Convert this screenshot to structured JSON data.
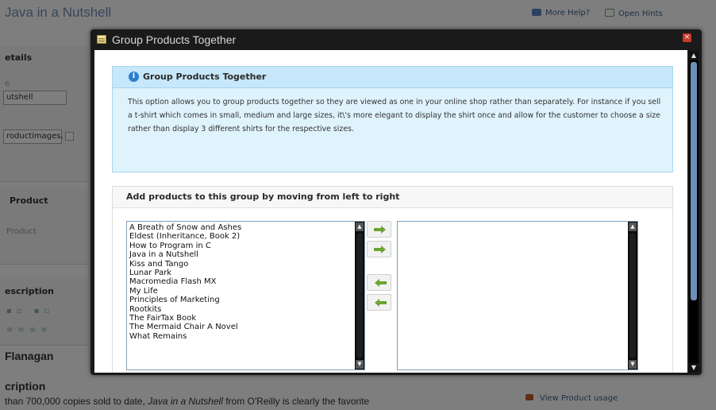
{
  "background": {
    "title": "Java in a Nutshell",
    "more_help": "More Help?",
    "open_hints": "Open Hints",
    "details_heading": "etails",
    "field_label_e": "e",
    "field_value_name": "utshell",
    "field_value_images": "roductimages,",
    "product_heading": "Product",
    "product_sub": "Product",
    "description_heading": "escription",
    "author": "Flanagan",
    "desc_heading2": "cription",
    "desc_text_prefix": "than 700,000 copies sold to date, ",
    "desc_text_italic": "Java in a Nutshell",
    "desc_text_suffix": " from O'Reilly is clearly the favorite",
    "view_usage": "View Product usage"
  },
  "dialog": {
    "title": "Group Products Together",
    "close_glyph": "×",
    "info": {
      "title": "Group Products Together",
      "icon_glyph": "i",
      "text": "This option allows you to group products together so they are viewed as one in your online shop rather than separately. For instance if you sell a t-shirt which comes in small, medium and large sizes, it\\'s more elegant to display the shirt once and allow for the customer to choose a size rather than display 3 different shirts for the respective sizes."
    },
    "add_panel": {
      "title": "Add products to this group by moving from left to right",
      "available_products": [
        "A Breath of Snow and Ashes",
        "Eldest (Inheritance, Book 2)",
        "How to Program in C",
        "Java in a Nutshell",
        "Kiss and Tango",
        "Lunar Park",
        "Macromedia Flash MX",
        "My Life",
        "Principles of Marketing",
        "Rootkits",
        "The FairTax Book",
        "The Mermaid Chair A Novel",
        "What Remains"
      ],
      "grouped_products": []
    }
  },
  "icons": {
    "scroll_up": "▲",
    "scroll_down": "▼"
  },
  "colors": {
    "info_bg": "#dff3fd",
    "info_header": "#c7e7fa",
    "arrow_green": "#6aa531",
    "dialog_frame": "#1a1a1a",
    "close_red": "#c63a2a"
  }
}
